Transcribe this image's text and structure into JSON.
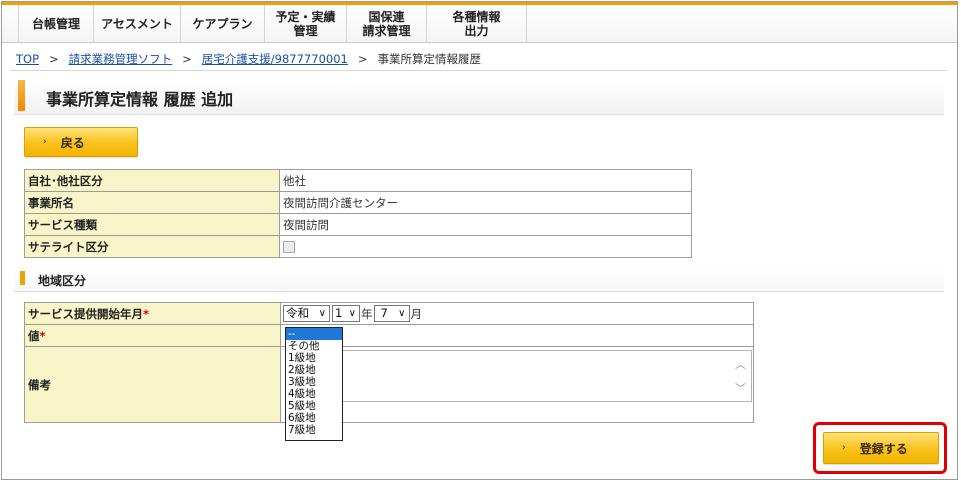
{
  "nav": {
    "items": [
      {
        "label": "台帳管理"
      },
      {
        "label": "アセスメント"
      },
      {
        "label": "ケアプラン"
      },
      {
        "label": "予定・実績\n管理"
      },
      {
        "label": "国保連\n請求管理"
      },
      {
        "label": "各種情報\n出力"
      }
    ]
  },
  "breadcrumb": {
    "top": "TOP",
    "sep": ">",
    "link1": "請求業務管理ソフト",
    "link2": "居宅介護支援/9877770001",
    "current": "事業所算定情報履歴"
  },
  "page": {
    "title": "事業所算定情報 履歴 追加"
  },
  "buttons": {
    "back_chevron": "›",
    "back": "戻る",
    "register_chevron": "›",
    "register": "登録する"
  },
  "info_table": {
    "rows": [
      {
        "label": "自社･他社区分",
        "value": "他社"
      },
      {
        "label": "事業所名",
        "value": "夜間訪問介護センター"
      },
      {
        "label": "サービス種類",
        "value": "夜間訪問"
      },
      {
        "label": "サテライト区分",
        "value": ""
      }
    ]
  },
  "section": {
    "title": "地域区分"
  },
  "form": {
    "start_label": "サービス提供開始年月",
    "required_mark": "*",
    "era_value": "令和",
    "year_value": "1",
    "year_unit": "年",
    "month_value": "7",
    "month_unit": "月",
    "caret": "∨",
    "value_label": "値",
    "remarks_label": "備考"
  },
  "dropdown": {
    "options": [
      "--",
      "その他",
      "1級地",
      "2級地",
      "3級地",
      "4級地",
      "5級地",
      "6級地",
      "7級地"
    ],
    "selected_index": 0
  },
  "textarea": {
    "scroll_up": "︿",
    "scroll_down": "﹀"
  },
  "colors": {
    "accent": "#f0a000",
    "header_cell": "#f8f5c8",
    "highlight": "#e00000",
    "selected_option": "#1e78d6"
  }
}
